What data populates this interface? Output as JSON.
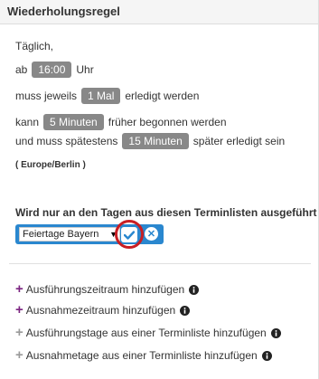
{
  "header": {
    "title": "Wiederholungsregel"
  },
  "rule": {
    "daily": "Täglich,",
    "from_label": "ab",
    "time": "16:00",
    "time_unit": "Uhr",
    "must_prefix": "muss jeweils",
    "count": "1 Mal",
    "must_suffix": "erledigt werden",
    "early_prefix": "kann",
    "early_value": "5 Minuten",
    "early_suffix": "früher begonnen werden",
    "late_prefix": "und muss spätestens",
    "late_value": "15 Minuten",
    "late_suffix": "später erledigt sein",
    "timezone": "( Europe/Berlin )"
  },
  "terminlisten": {
    "title": "Wird nur an den Tagen aus diesen Terminlisten ausgeführt",
    "selected": "Feiertage Bayern",
    "caret": "▼",
    "confirm_icon": "checkmark-icon",
    "remove_icon": "close-icon",
    "remove_glyph": "✕"
  },
  "actions": [
    {
      "label": "Ausführungszeitraum hinzufügen",
      "enabled": true
    },
    {
      "label": "Ausnahmezeitraum hinzufügen",
      "enabled": true
    },
    {
      "label": "Ausführungstage aus einer Terminliste hinzufügen",
      "enabled": false
    },
    {
      "label": "Ausnahmetage aus einer Terminliste hinzufügen",
      "enabled": false
    }
  ],
  "colors": {
    "accent_blue": "#2a87cf",
    "pill_gray": "#888888",
    "highlight_red": "#c81e24",
    "plus_purple": "#7b2481"
  }
}
